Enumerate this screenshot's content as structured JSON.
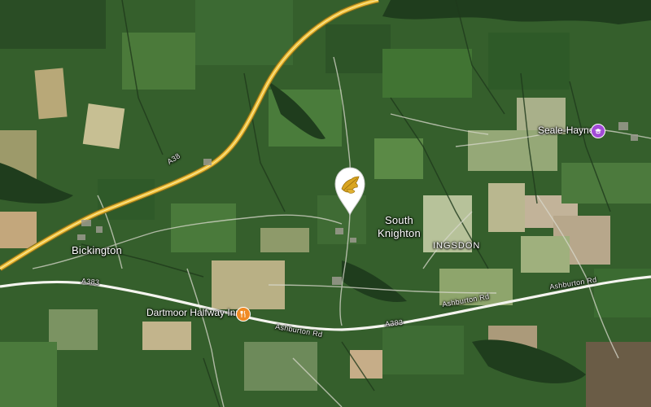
{
  "map": {
    "view": "satellite",
    "colors": {
      "motorway": "#f0c23a",
      "pin": "#ffffff",
      "pin_icon": "#d9a520",
      "restaurant_poi": "#f08a24",
      "university_poi": "#a24bd6"
    },
    "roads": {
      "a38": "A38",
      "a383_west": "A383",
      "a383_mid": "A383",
      "ashburton_rd_west": "Ashburton Rd",
      "ashburton_rd_mid": "Ashburton Rd",
      "ashburton_rd_east": "Ashburton Rd"
    },
    "places": {
      "bickington": "Bickington",
      "south_knighton_line1": "South",
      "south_knighton_line2": "Knighton",
      "ingsdon": "INGSDON"
    },
    "pois": {
      "seale_hayne": {
        "label": "Seale-Hayne",
        "icon": "university-icon"
      },
      "dartmoor_inn": {
        "label": "Dartmoor Halfway Inn",
        "icon": "restaurant-icon"
      }
    },
    "marker": {
      "icon": "oak-leaf-icon"
    }
  }
}
